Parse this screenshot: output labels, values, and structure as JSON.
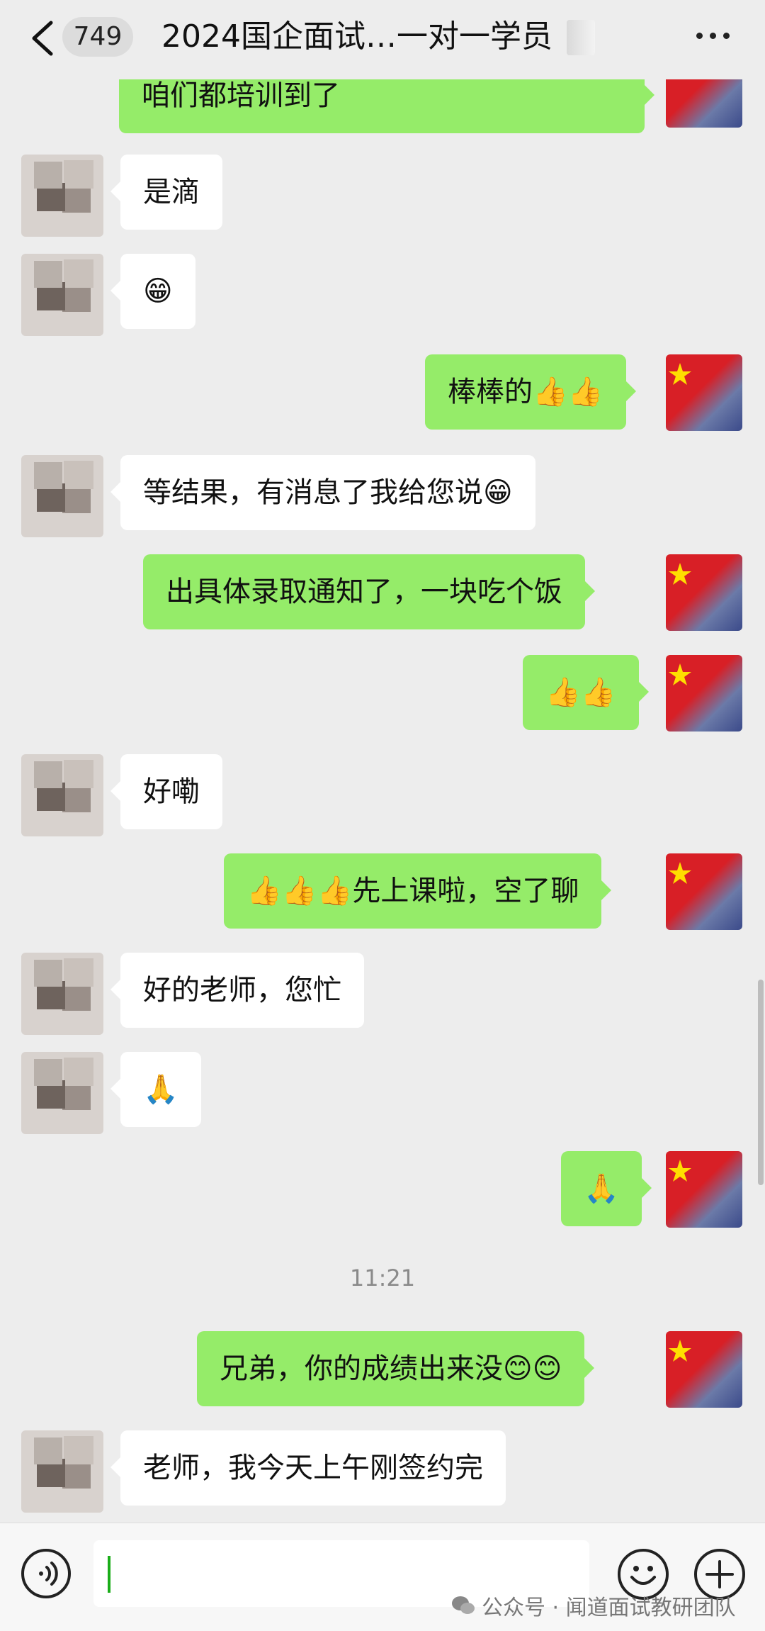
{
  "header": {
    "unread_count": "749",
    "title": "2024国企面试…一对一学员"
  },
  "messages": [
    {
      "side": "out",
      "text": "咱们都培训到了"
    },
    {
      "side": "in",
      "text": "是滴"
    },
    {
      "side": "in",
      "text": "😁"
    },
    {
      "side": "out",
      "text": "棒棒的👍👍"
    },
    {
      "side": "in",
      "text": "等结果，有消息了我给您说😁"
    },
    {
      "side": "out",
      "text": "出具体录取通知了，一块吃个饭"
    },
    {
      "side": "out",
      "text": "👍👍"
    },
    {
      "side": "in",
      "text": "好嘞"
    },
    {
      "side": "out",
      "text": "👍👍👍先上课啦，空了聊"
    },
    {
      "side": "in",
      "text": "好的老师，您忙"
    },
    {
      "side": "in",
      "text": "🙏"
    },
    {
      "side": "out",
      "text": "🙏"
    },
    {
      "side": "time",
      "text": "11:21"
    },
    {
      "side": "out",
      "text": "兄弟，你的成绩出来没😊😊"
    },
    {
      "side": "in",
      "text": "老师，我今天上午刚签约完"
    }
  ],
  "input": {
    "value": ""
  },
  "watermark": {
    "text": "公众号 · 闻道面试教研团队"
  },
  "icons": {
    "back": "chevron-left-icon",
    "more": "more-dots-icon",
    "voice": "voice-icon",
    "emoji": "emoji-icon",
    "plus": "plus-icon"
  },
  "colors": {
    "background": "#ededed",
    "outgoing_bubble": "#95ec69",
    "incoming_bubble": "#ffffff"
  }
}
